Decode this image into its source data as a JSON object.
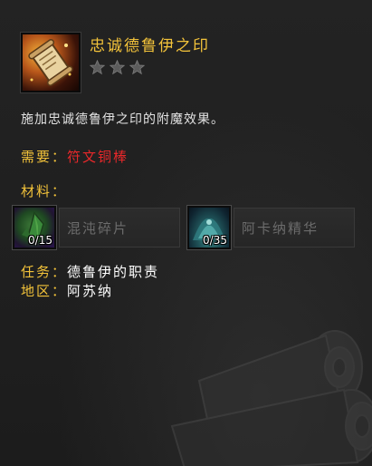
{
  "recipe": {
    "title": "忠诚德鲁伊之印",
    "icon": "scroll-enchant-icon",
    "rank_stars": 3,
    "rank_filled": 0,
    "description": "施加忠诚德鲁伊之印的附魔效果。"
  },
  "requires": {
    "label": "需要",
    "separator": "：",
    "value": "符文铜棒"
  },
  "materials": {
    "label": "材料：",
    "items": [
      {
        "name": "混沌碎片",
        "count": "0/15",
        "icon": "chaos-shard-icon"
      },
      {
        "name": "阿卡纳精华",
        "count": "0/35",
        "icon": "arcane-essence-icon"
      }
    ]
  },
  "quest": {
    "label": "任务：",
    "value": "德鲁伊的职责"
  },
  "zone": {
    "label": "地区：",
    "value": "阿苏纳"
  },
  "colors": {
    "title": "#f2c23a",
    "requires_value": "#e8282a",
    "reagent_name": "#6c6c6c"
  }
}
